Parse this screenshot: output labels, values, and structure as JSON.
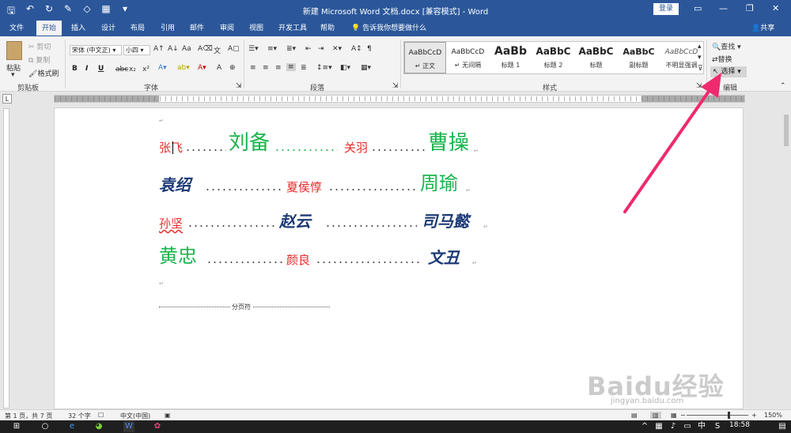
{
  "titlebar": {
    "title": "新建 Microsoft Word 文档.docx [兼容模式] - Word",
    "login": "登录",
    "minimize": "—",
    "restore": "❐",
    "close": "✕"
  },
  "tabs": {
    "items": [
      "文件",
      "开始",
      "插入",
      "设计",
      "布局",
      "引用",
      "邮件",
      "审阅",
      "视图",
      "开发工具",
      "帮助"
    ],
    "tell_me": "告诉我你想要做什么",
    "share": "共享"
  },
  "clipboard": {
    "paste": "粘贴",
    "cut": "剪切",
    "copy": "复制",
    "format_painter": "格式刷",
    "label": "剪贴板"
  },
  "font": {
    "name": "宋体 (中文正)",
    "size": "小四",
    "label": "字体",
    "bold": "B",
    "italic": "I",
    "underline": "U",
    "strike": "abc",
    "sub": "x₂",
    "sup": "x²"
  },
  "paragraph": {
    "label": "段落"
  },
  "styles": {
    "label": "样式",
    "items": [
      {
        "sample": "AaBbCcD",
        "name": "↵ 正文"
      },
      {
        "sample": "AaBbCcD",
        "name": "↵ 无间隔"
      },
      {
        "sample": "AaBb",
        "name": "标题 1"
      },
      {
        "sample": "AaBbC",
        "name": "标题 2"
      },
      {
        "sample": "AaBbC",
        "name": "标题"
      },
      {
        "sample": "AaBbC",
        "name": "副标题"
      },
      {
        "sample": "AaBbCcD",
        "name": "不明显强调"
      }
    ]
  },
  "editing": {
    "find": "查找",
    "replace": "替换",
    "select": "选择",
    "label": "编辑"
  },
  "document": {
    "lines": [
      [
        "张飞",
        "刘备",
        "关羽",
        "曹操"
      ],
      [
        "袁绍",
        "夏侯惇",
        "周瑜"
      ],
      [
        "孙坚",
        "赵云",
        "司马懿"
      ],
      [
        "黄忠",
        "颜良",
        "文丑"
      ]
    ],
    "page_break": "分页符"
  },
  "status": {
    "page": "第 1 页，共 7 页",
    "words": "32 个字",
    "language": "中文(中国)",
    "zoom": "150%",
    "zoom_level": 150
  },
  "taskbar": {
    "time": "18:58"
  },
  "watermark": {
    "brand": "Baidu经验",
    "url": "jingyan.baidu.com"
  },
  "colors": {
    "word_blue": "#2b579a",
    "name_red": "#e52b2b",
    "name_green": "#1ab44d",
    "name_blue": "#1c3a75",
    "arrow": "#ef2a6e"
  }
}
